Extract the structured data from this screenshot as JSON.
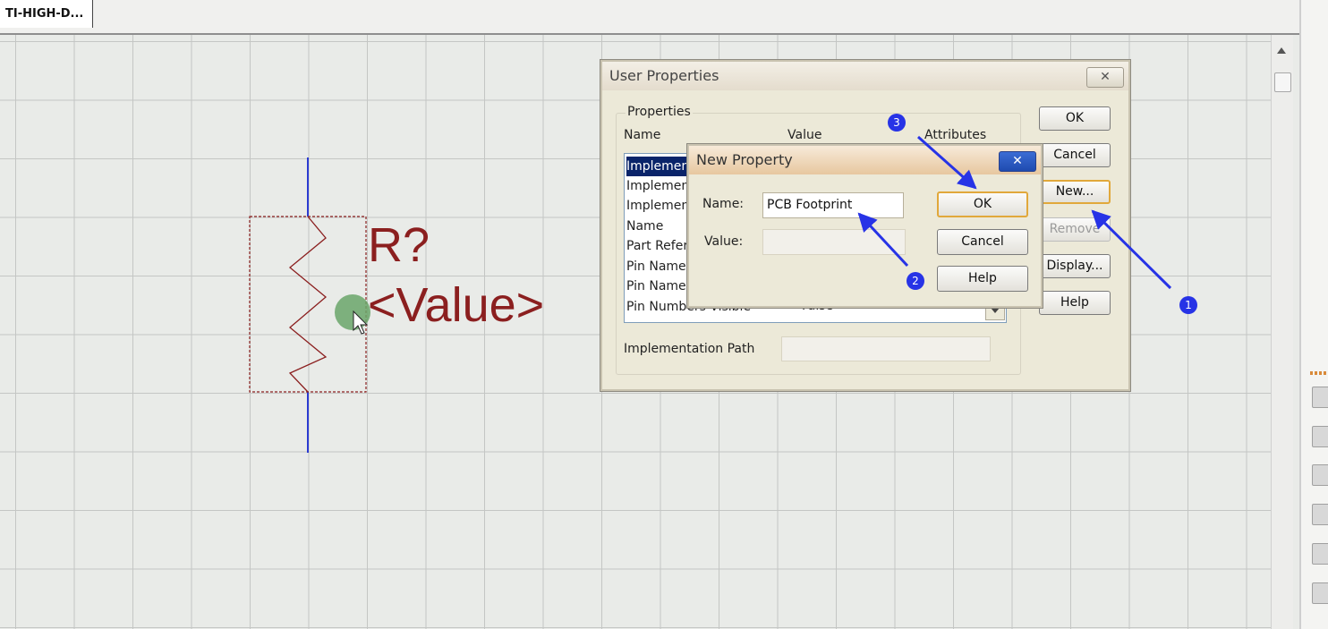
{
  "tab": {
    "label": "TI-HIGH-D..."
  },
  "schematic": {
    "refdes": "R?",
    "value": "<Value>"
  },
  "user_properties": {
    "title": "User Properties",
    "close_glyph": "✕",
    "group_label": "Properties",
    "col_name": "Name",
    "col_value": "Value",
    "col_attributes": "Attributes",
    "rows": [
      "Implement",
      "Implement",
      "Implement",
      "Name",
      "Part Refer",
      "Pin Names",
      "Pin Names",
      "Pin Numbers Visible"
    ],
    "last_row_value": "False",
    "impl_path_label": "Implementation Path",
    "buttons": {
      "ok": "OK",
      "cancel": "Cancel",
      "new": "New...",
      "remove": "Remove",
      "display": "Display...",
      "help": "Help"
    }
  },
  "new_property": {
    "title": "New Property",
    "close_glyph": "✕",
    "name_label": "Name:",
    "name_value": "PCB Footprint",
    "value_label": "Value:",
    "value_value": "",
    "buttons": {
      "ok": "OK",
      "cancel": "Cancel",
      "help": "Help"
    }
  },
  "annotations": {
    "badge1": "1",
    "badge2": "2",
    "badge3": "3"
  },
  "colors": {
    "schematic_text": "#8b1f1f",
    "pin_line": "#2b3bd0",
    "annotation": "#2733e6",
    "selection": "#0a246a"
  }
}
